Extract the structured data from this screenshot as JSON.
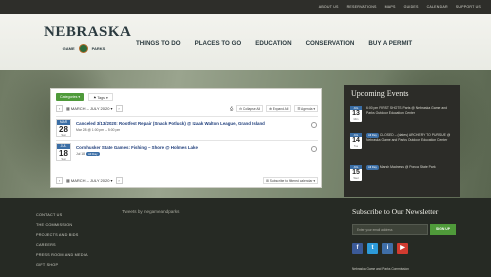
{
  "utility_nav": [
    "ABOUT US",
    "RESERVATIONS",
    "MAPS",
    "GUIDES",
    "CALENDAR",
    "SUPPORT US"
  ],
  "brand": {
    "title": "NEBRASKA",
    "sub_left": "GAME",
    "sub_right": "PARKS"
  },
  "main_nav": [
    "THINGS TO DO",
    "PLACES TO GO",
    "EDUCATION",
    "CONSERVATION",
    "BUY A PERMIT"
  ],
  "calendar": {
    "categories_label": "Categories",
    "tags_label": "Tags",
    "month_label": "MARCH – JULY 2020",
    "tools": [
      "Print",
      "Collapse All",
      "Expand All",
      "Agenda"
    ],
    "events": [
      {
        "month": "MAR",
        "day": "28",
        "weekday": "Sat",
        "title": "Canceled 3/13/2020: Rootfest Repair (Snack Potluck) @ Izaak Walton League, Grand Island",
        "time": "Mar 28 @ 1:00 pm – 5:00 pm"
      },
      {
        "month": "JUL",
        "day": "18",
        "weekday": "Sat",
        "title": "Cornhusker State Games: Fishing – Shore @ Holmes Lake",
        "time": "Jul 18",
        "tag": "All Day"
      }
    ],
    "subscribe_label": "Subscribe to filtered calendar"
  },
  "upcoming": {
    "title": "Upcoming Events",
    "items": [
      {
        "month": "JUL",
        "day": "13",
        "weekday": "Mon",
        "text": "6:00 pm FIRST SHOTS Parts @ Nebraska Game and Parks Outdoor Education Center"
      },
      {
        "month": "JUL",
        "day": "14",
        "weekday": "Tue",
        "tag": "All Day",
        "text": "CLOSED – (dates) ARCHERY TO PURSUE @ Nebraska Game and Parks Outdoor Education Center"
      },
      {
        "month": "JUL",
        "day": "15",
        "weekday": "Wed",
        "tag": "All Day",
        "text": "Marsh Madness @ Ponca State Park"
      }
    ]
  },
  "footer": {
    "links": [
      "CONTACT US",
      "THE COMMISSION",
      "PROJECTS AND BIDS",
      "CAREERS",
      "PRESS ROOM AND MEDIA",
      "GIFT SHOP"
    ],
    "tweets_label": "Tweets by negameandparks",
    "subscribe_title": "Subscribe to Our Newsletter",
    "email_placeholder": "Enter your email address",
    "signup_label": "SIGN UP",
    "social": [
      "f",
      "t",
      "i",
      "▶"
    ],
    "bottom_text": "Nebraska Game and Parks Commission"
  }
}
